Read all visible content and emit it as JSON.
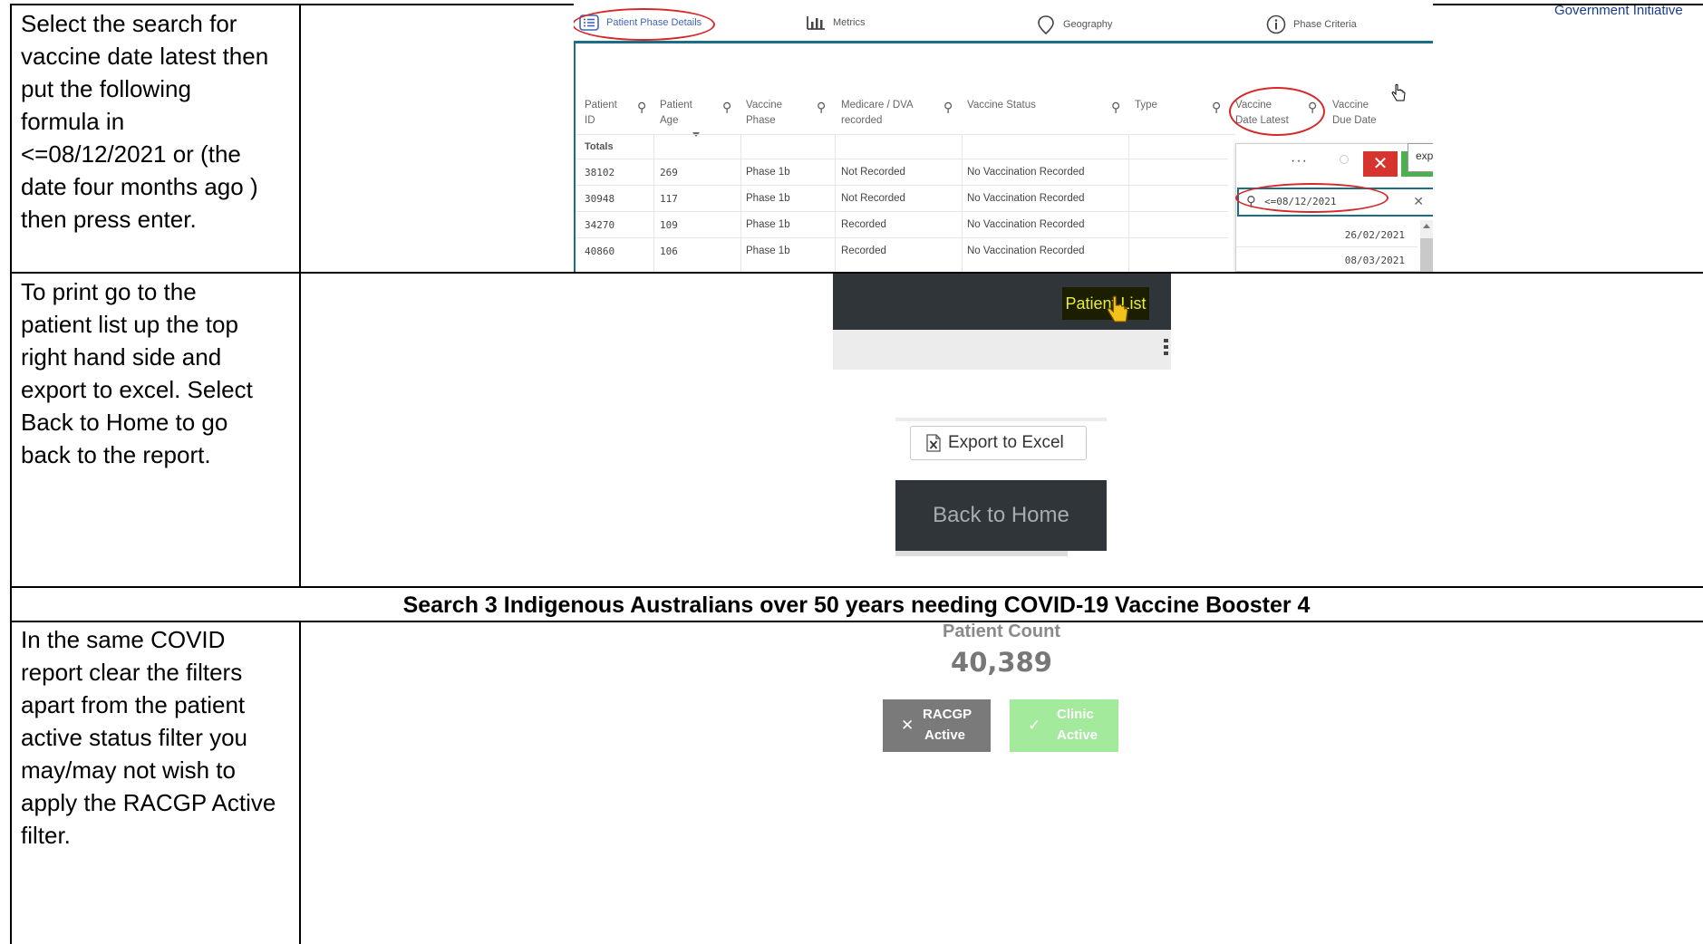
{
  "instructions": {
    "row1": [
      "Select the search for",
      "vaccine date latest then",
      "put the following",
      "formula in",
      "<=08/12/2021 or (the",
      "date four months ago )",
      "then press enter."
    ],
    "row2": [
      "To print go to the",
      "patient list up the top",
      "right hand side and",
      "export to excel. Select",
      "Back to Home to go",
      "back to the report."
    ],
    "row3": [
      "In the same COVID",
      "report clear the filters",
      "apart from the patient",
      "active status filter you",
      "may/may not wish to",
      "apply the RACGP Active",
      "filter."
    ]
  },
  "section_heading": "Search 3  Indigenous Australians over 50 years needing COVID-19 Vaccine Booster 4",
  "top_banner": "An Australian Government Initiative",
  "qlik": {
    "tabs": {
      "patient_phase_details": "Patient Phase Details",
      "metrics": "Metrics",
      "geography": "Geography",
      "phase_criteria": "Phase Criteria"
    },
    "headers": {
      "patient_id": [
        "Patient",
        "ID"
      ],
      "patient_age": [
        "Patient",
        "Age"
      ],
      "vaccine_phase": [
        "Vaccine",
        "Phase"
      ],
      "medicare": [
        "Medicare / DVA",
        "recorded"
      ],
      "vaccine_status": [
        "Vaccine Status"
      ],
      "type": [
        "Type"
      ],
      "vaccine_date_latest": [
        "Vaccine",
        "Date Latest"
      ],
      "vaccine_due_date": [
        "Vaccine",
        "Due Date"
      ]
    },
    "totals_label": "Totals",
    "rows": [
      {
        "id": "38102",
        "age": "269",
        "phase": "Phase 1b",
        "medicare": "Not Recorded",
        "status": "No Vaccination Recorded"
      },
      {
        "id": "30948",
        "age": "117",
        "phase": "Phase 1b",
        "medicare": "Not Recorded",
        "status": "No Vaccination Recorded"
      },
      {
        "id": "34270",
        "age": "109",
        "phase": "Phase 1b",
        "medicare": "Recorded",
        "status": "No Vaccination Recorded"
      },
      {
        "id": "40860",
        "age": "106",
        "phase": "Phase 1b",
        "medicare": "Recorded",
        "status": "No Vaccination Recorded"
      }
    ],
    "popup": {
      "dots": "···",
      "search_value": "<=08/12/2021",
      "dates": [
        "26/02/2021",
        "08/03/2021"
      ]
    },
    "export_partial": "exp"
  },
  "patient_list_button": "Patient List",
  "export_to_excel": "Export to Excel",
  "back_to_home": "Back to Home",
  "patient_count": {
    "title": "Patient Count",
    "value": "40,389"
  },
  "filters": {
    "racgp": [
      "RACGP",
      "Active"
    ],
    "clinic": [
      "Clinic",
      "Active"
    ]
  },
  "colors": {
    "accent_teal": "#1a6e86",
    "highlight_red": "#d62828",
    "dark_panel": "#303539",
    "active_green": "#a3ea9c",
    "inactive_grey": "#7a7a7a"
  }
}
